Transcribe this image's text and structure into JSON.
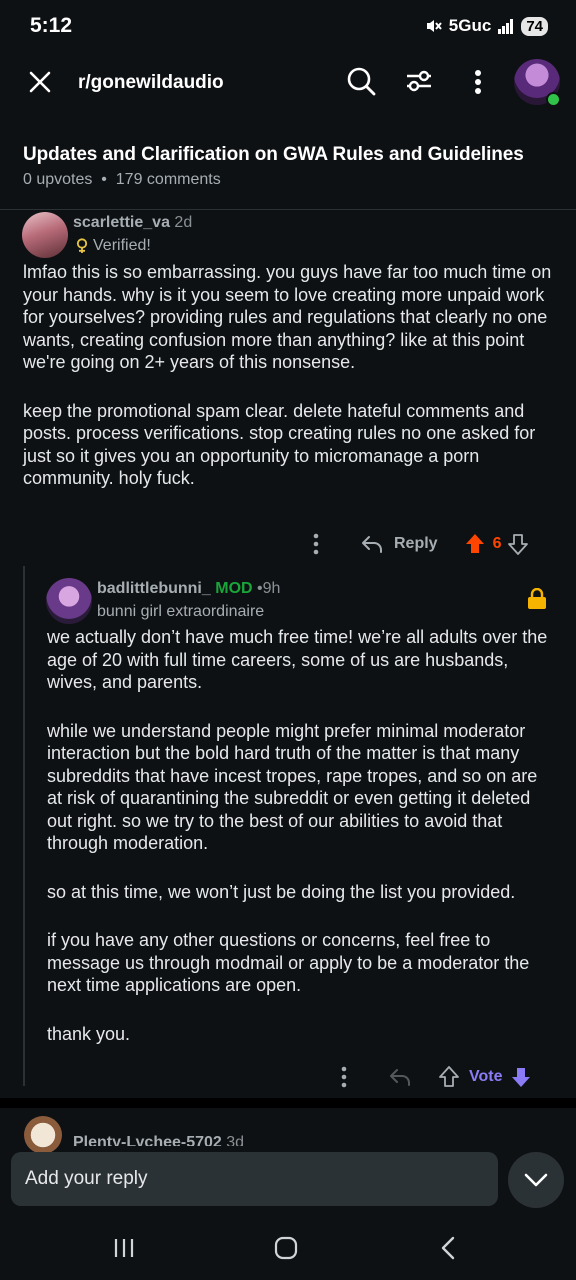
{
  "status": {
    "time": "5:12",
    "network": "5Guc",
    "battery": "74"
  },
  "header": {
    "subreddit": "r/gonewildaudio"
  },
  "post": {
    "title": "Updates and Clarification on GWA Rules and Guidelines",
    "upvotes": "0 upvotes",
    "comments": "179 comments"
  },
  "comment1": {
    "username": "scarlettie_va",
    "age": "2d",
    "flair": "Verified!",
    "paragraphs": [
      "lmfao this is so embarrassing. you guys have far too much time on your hands. why is it you seem to love creating more unpaid work for yourselves? providing rules and regulations that clearly no one wants, creating confusion more than anything? like at this point we're going on 2+ years of this nonsense.",
      "keep the promotional spam clear. delete hateful comments and posts. process verifications. stop creating rules no one asked for just so it gives you an opportunity to micromanage a porn community. holy fuck."
    ],
    "reply_label": "Reply",
    "score": "6",
    "upvote_color": "#ff4500"
  },
  "comment2": {
    "username": "badlittlebunni_",
    "mod_label": "MOD",
    "age": "9h",
    "flair": "bunni girl extraordinaire",
    "paragraphs": [
      "we actually don’t have much free time! we’re all adults over the age of 20 with full time careers, some of us are husbands, wives, and parents.",
      "while we understand people might prefer minimal moderator interaction but the bold hard truth of the matter is that many subreddits that have incest tropes, rape tropes, and so on are at risk of quarantining the subreddit or even getting it deleted out right. so we try to the best of our abilities to avoid that through moderation.",
      "so at this time, we won’t just be doing the list you provided.",
      "if you have any other questions or concerns, feel free to message us through modmail or apply to be a moderator the next time applications are open.",
      "thank you."
    ],
    "vote_label": "Vote",
    "accent_color": "#8b7cf6"
  },
  "comment3": {
    "username": "Plenty-Lychee-5702",
    "age": "3d"
  },
  "reply_bar": {
    "placeholder": "Add your reply"
  }
}
